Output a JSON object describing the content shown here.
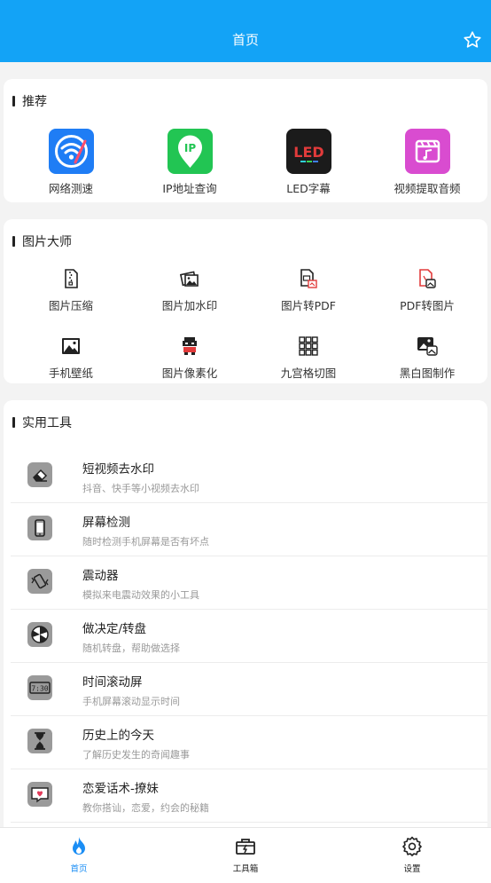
{
  "header": {
    "title": "首页"
  },
  "recommend": {
    "title": "推荐",
    "items": [
      {
        "label": "网络测速",
        "icon": "wifi-speed-icon",
        "color": "#1f7df5"
      },
      {
        "label": "IP地址查询",
        "icon": "ip-pin-icon",
        "color": "#22c553",
        "badge": "IP"
      },
      {
        "label": "LED字幕",
        "icon": "led-icon",
        "color": "#1b1b1b",
        "badge": "LED"
      },
      {
        "label": "视频提取音频",
        "icon": "video-audio-icon",
        "color": "#d94cd0"
      }
    ]
  },
  "image_master": {
    "title": "图片大师",
    "items": [
      {
        "label": "图片压缩",
        "icon": "file-zip-icon"
      },
      {
        "label": "图片加水印",
        "icon": "watermark-icon"
      },
      {
        "label": "图片转PDF",
        "icon": "image-to-pdf-icon"
      },
      {
        "label": "PDF转图片",
        "icon": "pdf-to-image-icon"
      },
      {
        "label": "手机壁纸",
        "icon": "wallpaper-icon"
      },
      {
        "label": "图片像素化",
        "icon": "pixel-icon"
      },
      {
        "label": "九宫格切图",
        "icon": "grid-nine-icon"
      },
      {
        "label": "黑白图制作",
        "icon": "black-white-icon"
      }
    ]
  },
  "tools": {
    "title": "实用工具",
    "items": [
      {
        "title": "短视频去水印",
        "desc": "抖音、快手等小视频去水印",
        "icon": "eraser-icon"
      },
      {
        "title": "屏幕检测",
        "desc": "随时检测手机屏幕是否有坏点",
        "icon": "phone-screen-icon"
      },
      {
        "title": "震动器",
        "desc": "模拟来电震动效果的小工具",
        "icon": "vibrate-icon"
      },
      {
        "title": "做决定/转盘",
        "desc": "随机转盘，帮助做选择",
        "icon": "wheel-icon"
      },
      {
        "title": "时间滚动屏",
        "desc": "手机屏幕滚动显示时间",
        "icon": "clock-display-icon",
        "badge": "7:30"
      },
      {
        "title": "历史上的今天",
        "desc": "了解历史发生的奇闻趣事",
        "icon": "hourglass-icon"
      },
      {
        "title": "恋爱话术-撩妹",
        "desc": "教你搭讪，恋爱，约会的秘籍",
        "icon": "love-chat-icon"
      }
    ]
  },
  "nav": {
    "items": [
      {
        "label": "首页",
        "icon": "flame-icon",
        "color": "#1b8ef5"
      },
      {
        "label": "工具箱",
        "icon": "toolbox-icon",
        "color": "#222222"
      },
      {
        "label": "设置",
        "icon": "gear-icon",
        "color": "#222222"
      }
    ]
  }
}
